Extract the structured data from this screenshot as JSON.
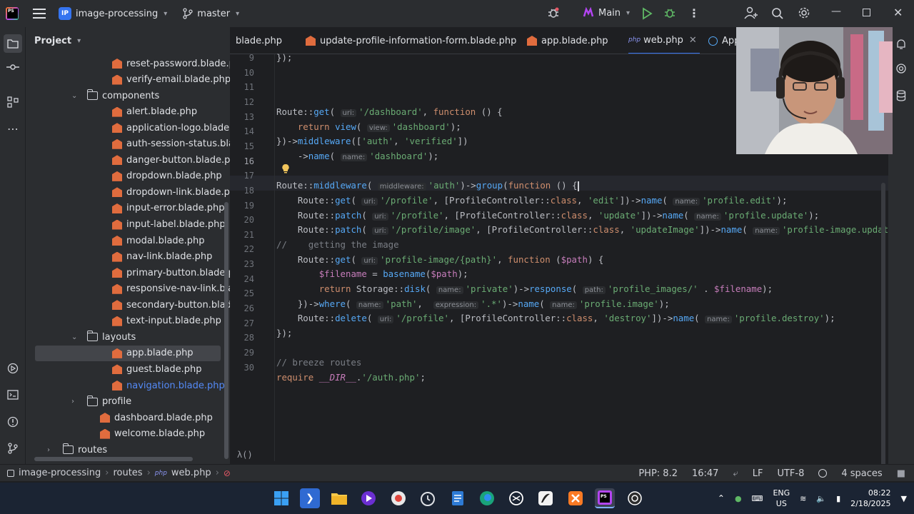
{
  "titlebar": {
    "project_badge": "IP",
    "project_name": "image-processing",
    "branch": "master",
    "run_config": "Main"
  },
  "project_panel": {
    "title": "Project",
    "items": [
      {
        "label": "reset-password.blade.php",
        "type": "blade"
      },
      {
        "label": "verify-email.blade.php",
        "type": "blade"
      },
      {
        "label": "components",
        "type": "folder",
        "expanded": true
      },
      {
        "label": "alert.blade.php",
        "type": "blade"
      },
      {
        "label": "application-logo.blade.php",
        "type": "blade"
      },
      {
        "label": "auth-session-status.blade.p",
        "type": "blade"
      },
      {
        "label": "danger-button.blade.php",
        "type": "blade"
      },
      {
        "label": "dropdown.blade.php",
        "type": "blade"
      },
      {
        "label": "dropdown-link.blade.php",
        "type": "blade"
      },
      {
        "label": "input-error.blade.php",
        "type": "blade"
      },
      {
        "label": "input-label.blade.php",
        "type": "blade"
      },
      {
        "label": "modal.blade.php",
        "type": "blade"
      },
      {
        "label": "nav-link.blade.php",
        "type": "blade"
      },
      {
        "label": "primary-button.blade.php",
        "type": "blade"
      },
      {
        "label": "responsive-nav-link.blade.p",
        "type": "blade"
      },
      {
        "label": "secondary-button.blade.php",
        "type": "blade"
      },
      {
        "label": "text-input.blade.php",
        "type": "blade"
      },
      {
        "label": "layouts",
        "type": "folder",
        "expanded": true
      },
      {
        "label": "app.blade.php",
        "type": "blade",
        "selected": true
      },
      {
        "label": "guest.blade.php",
        "type": "blade"
      },
      {
        "label": "navigation.blade.php",
        "type": "blade",
        "highlight": true
      },
      {
        "label": "profile",
        "type": "folder",
        "expanded": false
      },
      {
        "label": "dashboard.blade.php",
        "type": "blade"
      },
      {
        "label": "welcome.blade.php",
        "type": "blade"
      },
      {
        "label": "routes",
        "type": "folder",
        "expanded": false
      }
    ]
  },
  "tabs": [
    {
      "label": "blade.php"
    },
    {
      "label": "update-profile-information-form.blade.php"
    },
    {
      "label": "app.blade.php"
    },
    {
      "label": "web.php",
      "active": true,
      "prefix": "php"
    },
    {
      "label": "App"
    }
  ],
  "code": {
    "line_numbers": [
      "9",
      "10",
      "11",
      "12",
      "13",
      "14",
      "15",
      "16",
      "17",
      "18",
      "19",
      "20",
      "21",
      "22",
      "23",
      "24",
      "25",
      "26",
      "27",
      "28",
      "29",
      "30"
    ],
    "current_line": "16",
    "lambda": "λ()"
  },
  "statusbar": {
    "crumbs": [
      "image-processing",
      "routes",
      "web.php"
    ],
    "php": "PHP: 8.2",
    "position": "16:47",
    "line_sep": "LF",
    "encoding": "UTF-8",
    "indent": "4 spaces"
  },
  "taskbar": {
    "lang_top": "ENG",
    "lang_bottom": "US",
    "time": "08:22",
    "date": "2/18/2025"
  },
  "colors": {
    "accent": "#3574f0",
    "blade_icon": "#e06c3e",
    "keyword": "#cf8e6d",
    "function": "#56a8f5",
    "string": "#6aab73",
    "variable": "#c77dbb"
  }
}
